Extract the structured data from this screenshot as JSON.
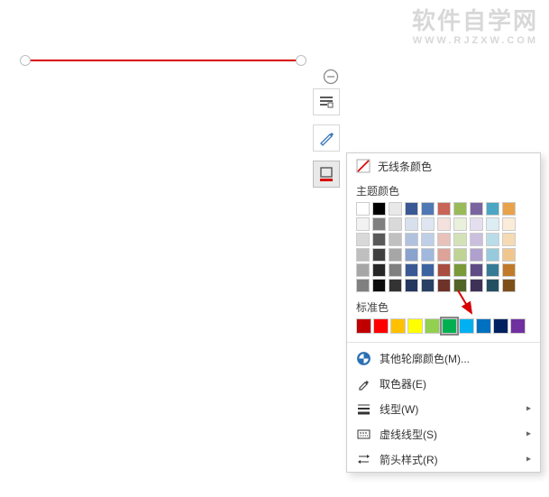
{
  "watermark": {
    "line1": "软件自学网",
    "line2": "WWW.RJZXW.COM"
  },
  "ctx_buttons": [
    "minus-icon",
    "layout-icon",
    "pen-icon",
    "outline-shape-icon"
  ],
  "panel": {
    "no_line_label": "无线条颜色",
    "theme_title": "主题颜色",
    "theme_rows": [
      [
        "#ffffff",
        "#000000",
        "#e8e8e8",
        "#3a5894",
        "#5078b4",
        "#c86458",
        "#9aba5a",
        "#7a64a0",
        "#4aa6c2",
        "#e8a24a"
      ],
      [
        "#f2f2f2",
        "#7f7f7f",
        "#d9d9d9",
        "#d8e0ee",
        "#dfe6f2",
        "#f4e0dc",
        "#e9f0db",
        "#e4dfee",
        "#dcedf3",
        "#faecd9"
      ],
      [
        "#d9d9d9",
        "#595959",
        "#c0c0c0",
        "#b1c2de",
        "#bfcfe7",
        "#e8c1ba",
        "#d4e2b8",
        "#cac0de",
        "#badce8",
        "#f5dab4"
      ],
      [
        "#bfbfbf",
        "#404040",
        "#a6a6a6",
        "#8aa3cd",
        "#9fb8dc",
        "#dda298",
        "#bed394",
        "#afa0cd",
        "#97cadd",
        "#efc78e"
      ],
      [
        "#a6a6a6",
        "#262626",
        "#808080",
        "#3a5894",
        "#3c62a0",
        "#a84d40",
        "#7a9a3a",
        "#5f4b85",
        "#357b95",
        "#c07a29"
      ],
      [
        "#808080",
        "#0d0d0d",
        "#333333",
        "#24375e",
        "#274064",
        "#6e3229",
        "#506426",
        "#3e3157",
        "#235061",
        "#7d501b"
      ]
    ],
    "standard_title": "标准色",
    "standard_colors": [
      "#c00000",
      "#ff0000",
      "#ffc000",
      "#ffff00",
      "#92d050",
      "#00b050",
      "#00b0f0",
      "#0070c0",
      "#002060",
      "#7030a0"
    ],
    "selected_standard_index": 5,
    "more_label": "其他轮廓颜色(M)...",
    "picker_label": "取色器(E)",
    "weight_label": "线型(W)",
    "dash_label": "虚线线型(S)",
    "arrow_label": "箭头样式(R)"
  }
}
